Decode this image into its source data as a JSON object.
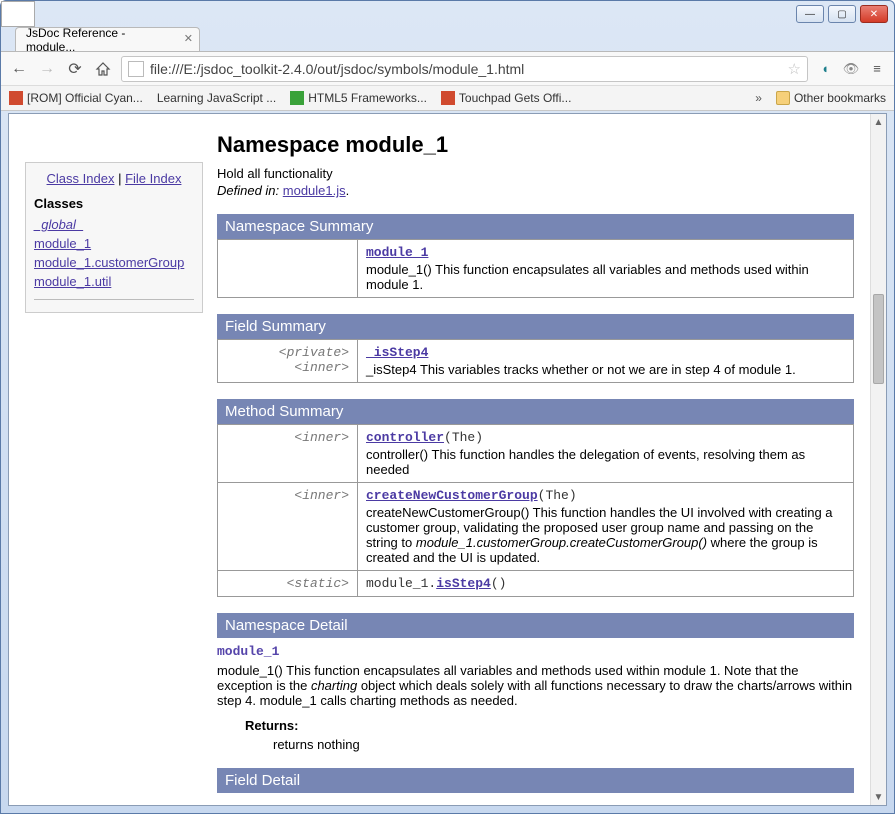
{
  "window": {
    "min": "—",
    "max": "▢",
    "close": "✕"
  },
  "tab": {
    "title": "JsDoc Reference - module..."
  },
  "url": "file:///E:/jsdoc_toolkit-2.4.0/out/jsdoc/symbols/module_1.html",
  "bookmarks": {
    "items": [
      {
        "icon": "red",
        "label": "[ROM] Official Cyan..."
      },
      {
        "icon": "page",
        "label": "Learning JavaScript ..."
      },
      {
        "icon": "green",
        "label": "HTML5 Frameworks..."
      },
      {
        "icon": "red",
        "label": "Touchpad Gets Offi..."
      }
    ],
    "other": "Other bookmarks"
  },
  "sidebar": {
    "class_index": "Class Index",
    "file_index": "File Index",
    "classes_heading": "Classes",
    "items": [
      {
        "label": "_global_"
      },
      {
        "label": "module_1"
      },
      {
        "label": "module_1.customerGroup"
      },
      {
        "label": "module_1.util"
      }
    ]
  },
  "page": {
    "title": "Namespace module_1",
    "tagline": "Hold all functionality",
    "defined_prefix": "Defined in: ",
    "defined_link": "module1.js",
    "namespace_summary_head": "Namespace Summary",
    "field_summary_head": "Field Summary",
    "method_summary_head": "Method Summary",
    "namespace_detail_head": "Namespace Detail",
    "field_detail_head": "Field Detail",
    "ns_summary": {
      "name": "module_1",
      "desc": "module_1() This function encapsulates all variables and methods used within module 1."
    },
    "field_summary": {
      "attrs": "<private> <inner>",
      "name": "_isStep4",
      "desc": "_isStep4 This variables tracks whether or not we are in step 4 of module 1."
    },
    "methods": [
      {
        "attrs": "<inner>",
        "name": "controller",
        "args": "(The)",
        "desc": "controller() This function handles the delegation of events, resolving them as needed"
      },
      {
        "attrs": "<inner>",
        "name": "createNewCustomerGroup",
        "args": "(The)",
        "desc_pre": "createNewCustomerGroup() This function handles the UI involved with creating a customer group, validating the proposed user group name and passing on the string to ",
        "desc_em": "module_1.customerGroup.createCustomerGroup()",
        "desc_post": " where the group is created and the UI is updated."
      },
      {
        "attrs": "<static>",
        "owner": "module_1.",
        "name": "isStep4",
        "args": "()",
        "desc": ""
      }
    ],
    "detail": {
      "name": "module_1",
      "body_pre": "module_1() This function encapsulates all variables and methods used within module 1. Note that the exception is the ",
      "body_em": "charting",
      "body_post": " object which deals solely with all functions necessary to draw the charts/arrows within step 4. module_1 calls charting methods as needed.",
      "returns_label": "Returns:",
      "returns_value": "returns nothing"
    }
  }
}
